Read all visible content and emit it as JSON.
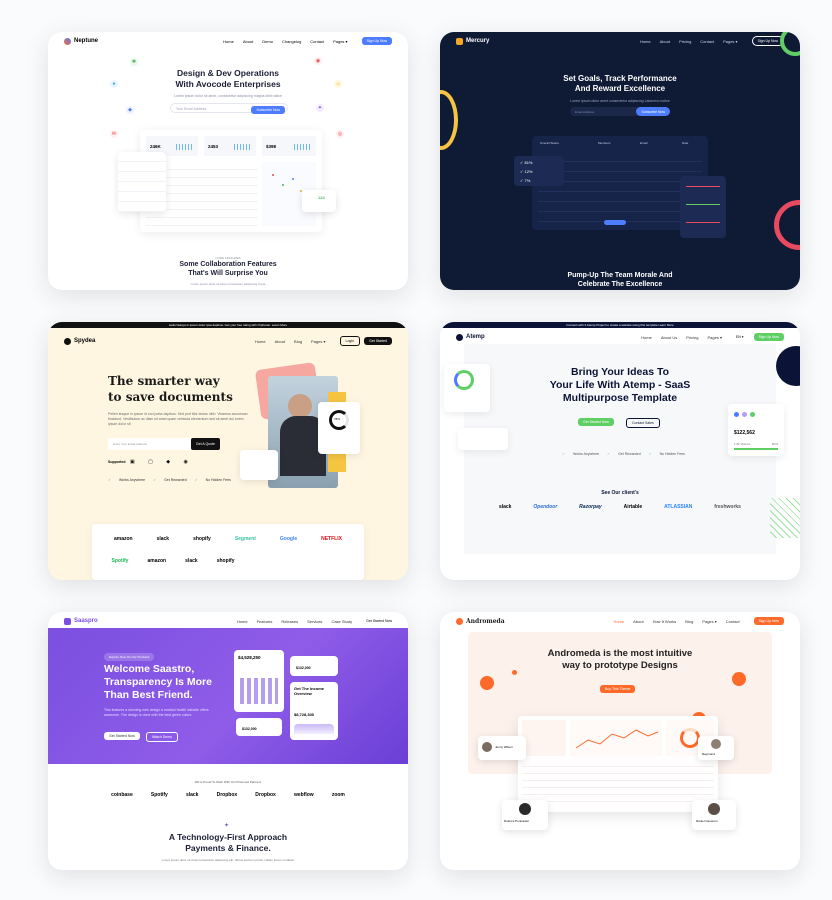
{
  "cards": {
    "neptune": {
      "logo": "Neptune",
      "nav": [
        "Home",
        "About",
        "Demo",
        "Changelog",
        "Contact",
        "Pages ▾"
      ],
      "cta": "Sign Up Now",
      "headline": "Design & Dev Operations\nWith Avocode Enterprises",
      "sub": "Lorem ipsum dolor sit amet, consectetur adipiscing magna kibit notice",
      "email_placeholder": "Your Email Address",
      "subscribe": "Subscribe Now",
      "stat1": "246K",
      "stat2": "2453",
      "stat3": "$398",
      "widget_value": "124",
      "section_tag": "CORE FEATURES",
      "section_title": "Some Collaboration Features\nThat's Will Surprise You",
      "section_sub": "Lorem ipsum dolor sit amet consectetur adipiscing hosta"
    },
    "mercury": {
      "logo": "Mercury",
      "nav": [
        "Home",
        "About",
        "Pricing",
        "Contact",
        "Pages ▾"
      ],
      "cta": "Sign Up Now",
      "headline": "Set Goals, Track Performance\nAnd Reward Excellence",
      "sub": "Lorem ipsum dolor amet consectetur adipiscing Laboreno notice",
      "email_placeholder": "Email Address",
      "subscribe": "Subscribe Now",
      "table_title": "Overall Status",
      "columns": [
        "Members",
        "Email",
        "Date"
      ],
      "pct1": "81%",
      "pct2": "12%",
      "pct3": "7%",
      "footer_title": "Pump-Up The Team Morale And\nCelebrate The Excellence"
    },
    "spydea": {
      "topbar": "Hello! Easya in ipsum dolor ipsa dapibus. Get your free rating with Orphanar. Learn More",
      "logo": "Spydea",
      "nav": [
        "Home",
        "About",
        "Blog",
        "Pages ▾"
      ],
      "login": "Login",
      "cta": "Get Started",
      "headline": "The smarter way\nto save documents",
      "sub": "Pellen tesque in ipsum id orci porta dapibus. Sed port titor lectus nibh. Vivamus accumsan tincidunt. Vestibulum ac diam sit amet quam vehicula elementum sed sit amet dui lorem ipsum dolor sit",
      "email_placeholder": "Enter Your Email Address",
      "quote_btn": "Get A Quote",
      "supported": "Supported",
      "checks": [
        "Works Anywhere",
        "Get Rewarded",
        "No Hidden Fees"
      ],
      "widget_pct": "78%",
      "brands": [
        "amazon",
        "slack",
        "shopify",
        "Segment",
        "Google",
        "NETFLIX",
        "Spotify",
        "amazon",
        "slack",
        "shopify"
      ]
    },
    "atemp": {
      "topbar": "Connect with 2 Atemp Project to create a website using this template Learn More",
      "logo": "Atemp",
      "nav": [
        "Home",
        "About Us",
        "Pricing",
        "Pages ▾"
      ],
      "lang": "EN ▾",
      "cta": "Sign Up Now",
      "headline": "Bring Your Ideas To\nYour Life With Atemp - SaaS\nMultipurpose Template",
      "primary_btn": "Get Started Now",
      "secondary_btn": "Contact Sales",
      "checks": [
        "Works Anywhere",
        "Get Rewarded",
        "No Hidden Fees"
      ],
      "amount": "$122,562",
      "amount_label": "1.5k Visitors",
      "amount_pct": "80%",
      "clients_title": "See Our client's",
      "clients": [
        "slack",
        "Opendoor",
        "Razorpay",
        "Airtable",
        "ATLASSIAN",
        "freshworks"
      ]
    },
    "saaspro": {
      "logo": "Saaspro",
      "nav": [
        "Home",
        "Features",
        "Releases",
        "Services",
        "Case Study"
      ],
      "cta": "Get Started Now",
      "badge": "Explore Now On Our Products",
      "headline": "Welcome Saastro,\nTransparency Is More\nThan Best Friend.",
      "sub": "This features a stunning web design a marked health website offers awesome. The design is done with the best green colors.",
      "primary_btn": "Get Started Now",
      "secondary_btn": "Watch Demo",
      "chart_value": "$4,528,250",
      "card2_value": "$132,000",
      "card3_title": "Get The Income\nOverview",
      "card3_value": "$8,728,300",
      "card4_value": "$132,000",
      "partners_title": "We're Proud To Work With Our Preferred Partners",
      "partners": [
        "coinbase",
        "Spotify",
        "slack",
        "Dropbox",
        "Dropbox",
        "webflow",
        "zoom"
      ],
      "section_title": "A Technology-First Approach\nPayments & Finance.",
      "section_sub": "Lorem ipsum dolor sit amet consectetur adipiscing elit. Varius aucturm portor nullam ipsum curabitur"
    },
    "andromeda": {
      "logo": "Andromeda",
      "nav": [
        "Home",
        "About",
        "How It Works",
        "Blog",
        "Pages ▾",
        "Contact"
      ],
      "cta": "Sign Up Now",
      "headline": "Andromeda is the most intuitive\nway to prototype Designs",
      "primary_btn": "Buy This Theme",
      "person1": "Jenny Wilson",
      "person2": "Raymond",
      "person3": "Dolores Pontranter",
      "person4": "Daniel Cameron"
    }
  },
  "colors": {
    "blue": "#4e7cff",
    "mercury_bg": "#0f1a35",
    "spydea_bg": "#fff6e2",
    "green": "#5fcf65",
    "purple": "#7b4fe0",
    "orange": "#ff6a2a"
  }
}
